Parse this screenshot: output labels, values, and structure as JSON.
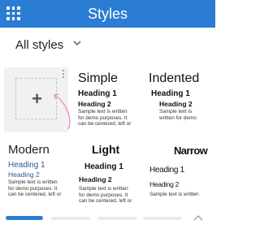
{
  "header": {
    "title": "Styles",
    "menu_icon": "grid-icon"
  },
  "filter": {
    "label": "All styles",
    "chevron_icon": "chevron-down-icon"
  },
  "new_style": {
    "icon": "plus-icon",
    "more_icon": "more-vertical-icon",
    "hint_icon": "curved-arrow-icon"
  },
  "styles": [
    {
      "name": "Simple",
      "heading1": "Heading 1",
      "heading2": "Heading 2",
      "body": "Sample text is written for demo purposes. It can be centered, left or right aligned. Sample text is"
    },
    {
      "name": "Indented",
      "heading1": "Heading 1",
      "heading2": "Heading 2",
      "body": "Sample text is written for demo purposes. It"
    },
    {
      "name": "Modern",
      "heading1": "Heading 1",
      "heading2": "Heading 2",
      "body": "Sample text is written for demo purposes. It can be centered, left or right aligned. Sample text is"
    },
    {
      "name": "Light",
      "heading1": "Heading 1",
      "heading2": "Heading 2",
      "body": "Sample text is written for demo purposes. It can be centered, left or right"
    },
    {
      "name": "Narrow",
      "heading1": "Heading 1",
      "heading2": "Heading 2",
      "body": "Sample text is written for"
    }
  ],
  "pager": {
    "pages": 5,
    "current": 1
  },
  "colors": {
    "accent": "#2b7cd3",
    "modern_heading": "#2b5797",
    "arrow": "#e59ad2"
  }
}
